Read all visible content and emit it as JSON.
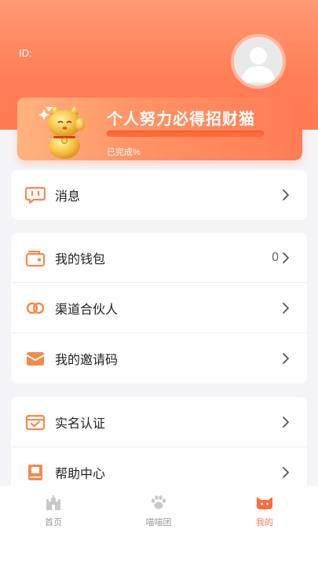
{
  "profile": {
    "id_label": "ID:"
  },
  "banner": {
    "title": "个人努力必得招财猫",
    "progress_label": "已完成%",
    "progress_fraction": 0
  },
  "menu": {
    "messages": {
      "label": "消息"
    },
    "wallet": {
      "label": "我的钱包",
      "value": "0"
    },
    "partner": {
      "label": "渠道合伙人"
    },
    "invite": {
      "label": "我的邀请码"
    },
    "verify": {
      "label": "实名认证"
    },
    "help": {
      "label": "帮助中心"
    }
  },
  "tabbar": {
    "home": {
      "label": "首页",
      "icon": "castle-icon"
    },
    "team": {
      "label": "喵喵团",
      "icon": "paw-icon"
    },
    "mine": {
      "label": "我的",
      "icon": "cat-face-icon",
      "active": true
    }
  },
  "colors": {
    "accent": "#ff7a52",
    "header": "#ff8a60",
    "icon_orange": "#f58a4a"
  }
}
